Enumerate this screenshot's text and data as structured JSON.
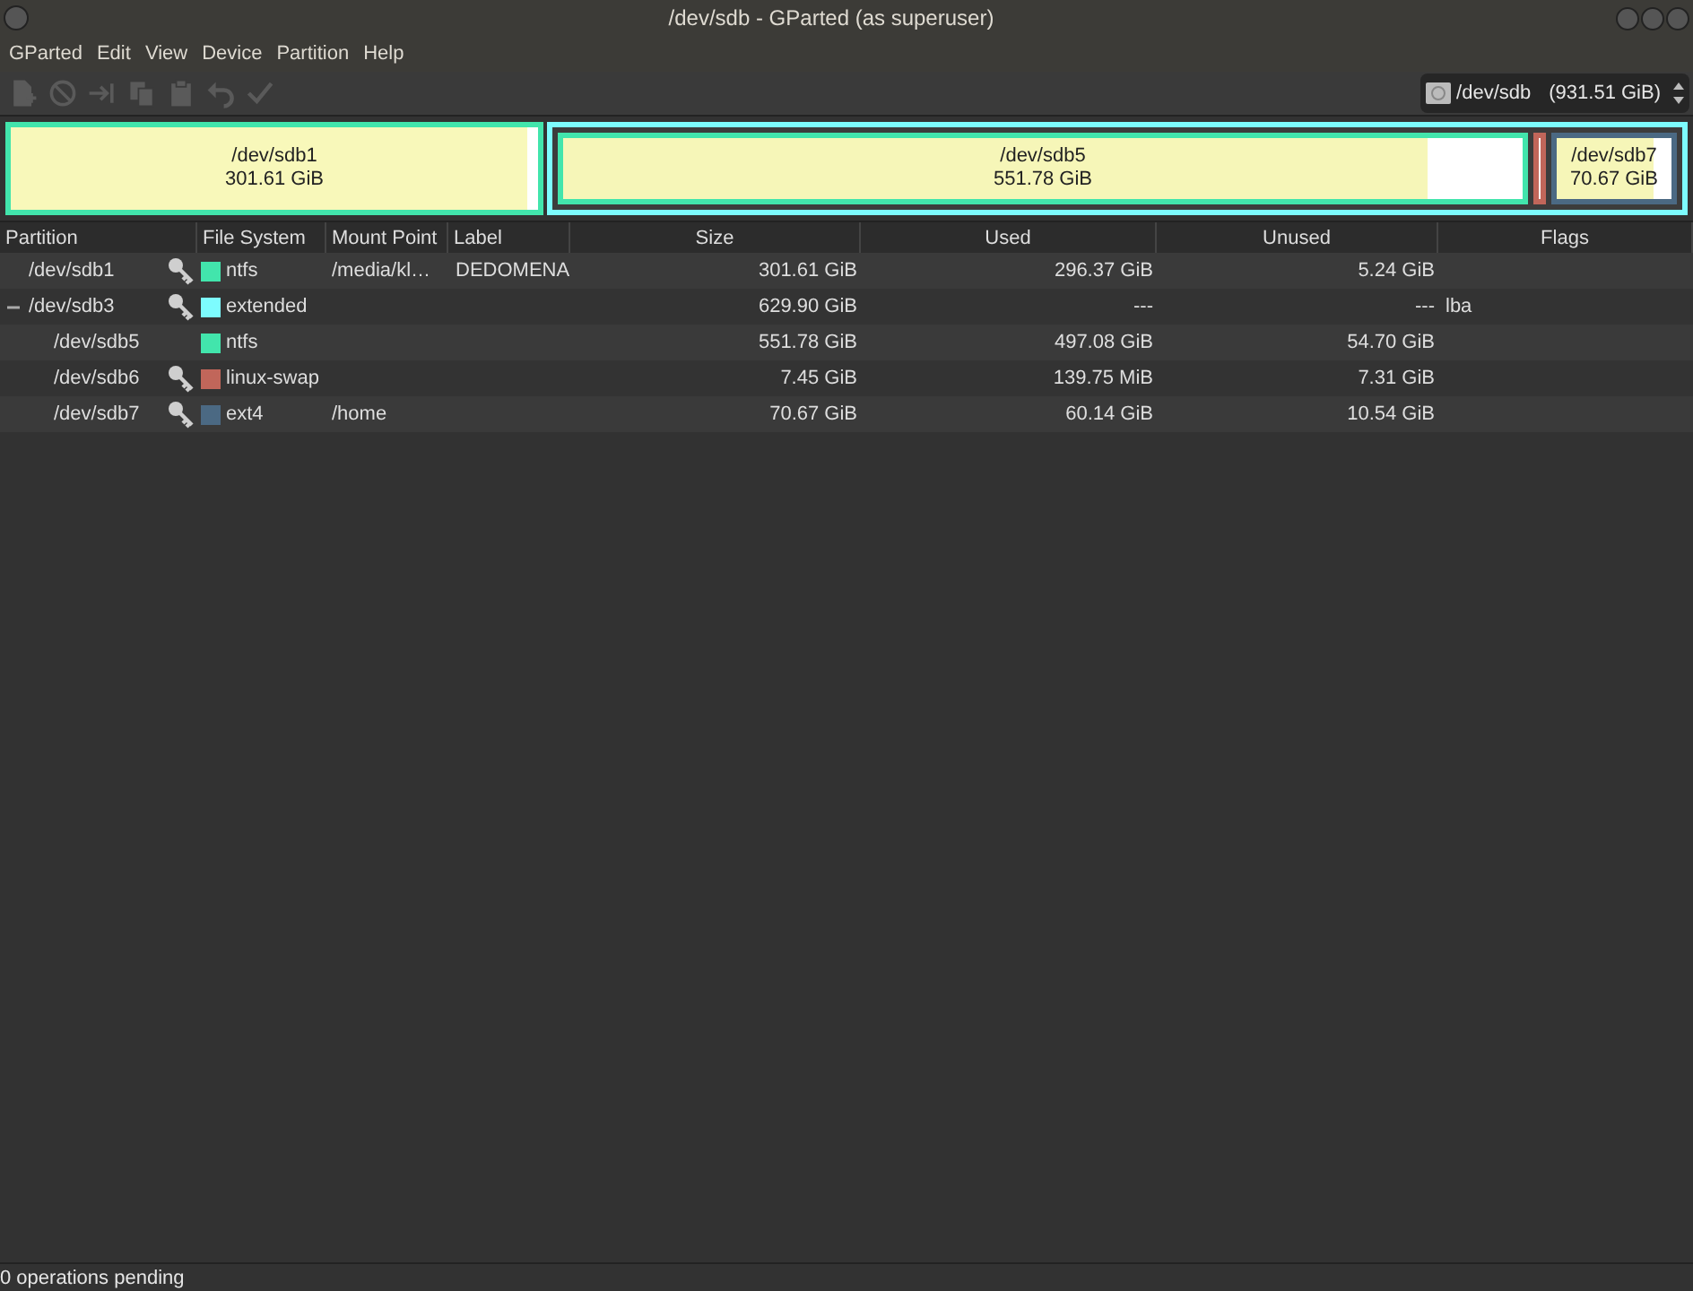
{
  "window": {
    "title": "/dev/sdb - GParted (as superuser)"
  },
  "menu": [
    "GParted",
    "Edit",
    "View",
    "Device",
    "Partition",
    "Help"
  ],
  "toolbar": [
    {
      "kind": "new",
      "disabled": true
    },
    {
      "kind": "delete",
      "disabled": true
    },
    {
      "kind": "resize",
      "disabled": true
    },
    {
      "kind": "copy",
      "disabled": true
    },
    {
      "kind": "paste",
      "disabled": true
    },
    {
      "kind": "undo",
      "disabled": true
    },
    {
      "kind": "apply",
      "disabled": true
    }
  ],
  "device": {
    "name": "/dev/sdb",
    "size": "(931.51 GiB)"
  },
  "disk_map": [
    {
      "kind": "primary",
      "name": "/dev/sdb1",
      "size": "301.61 GiB",
      "color": "#42e5ac",
      "level": 0.98
    },
    {
      "kind": "extended",
      "color": "#7dfcfe",
      "children": [
        {
          "kind": "logical",
          "name": "/dev/sdb5",
          "size": "551.78 GiB",
          "color": "#42e5ac",
          "level": 0.9
        },
        {
          "kind": "logical",
          "color": "#c1665a"
        },
        {
          "kind": "logical",
          "name": "/dev/sdb7",
          "size": "70.67 GiB",
          "color": "#4b6983",
          "level": 0.85
        }
      ]
    }
  ],
  "table": {
    "columns": [
      "Partition",
      "File System",
      "Mount Point",
      "Label",
      "Size",
      "Used",
      "Unused",
      "Flags"
    ],
    "rows": [
      {
        "partition": "/dev/sdb1",
        "locked": true,
        "filesystem": "ntfs",
        "color": "#42e5ac",
        "mount_point": "/media/kl…",
        "label": "DEDOMENA",
        "size": "301.61 GiB",
        "used": "296.37 GiB",
        "unused": "5.24 GiB"
      },
      {
        "partition": "/dev/sdb3",
        "locked": true,
        "expanded": true,
        "filesystem": "extended",
        "color": "#7dfcfe",
        "size": "629.90 GiB",
        "used": "---",
        "unused": "---",
        "flags": "lba",
        "children": [
          {
            "partition": "/dev/sdb5",
            "locked": false,
            "filesystem": "ntfs",
            "color": "#42e5ac",
            "size": "551.78 GiB",
            "used": "497.08 GiB",
            "unused": "54.70 GiB"
          },
          {
            "partition": "/dev/sdb6",
            "locked": true,
            "filesystem": "linux-swap",
            "color": "#c1665a",
            "size": "7.45 GiB",
            "used": "139.75 MiB",
            "unused": "7.31 GiB"
          },
          {
            "partition": "/dev/sdb7",
            "locked": true,
            "filesystem": "ext4",
            "color": "#4b6983",
            "mount_point": "/home",
            "size": "70.67 GiB",
            "used": "60.14 GiB",
            "unused": "10.54 GiB"
          }
        ]
      }
    ]
  },
  "status_bar": "0 operations pending"
}
